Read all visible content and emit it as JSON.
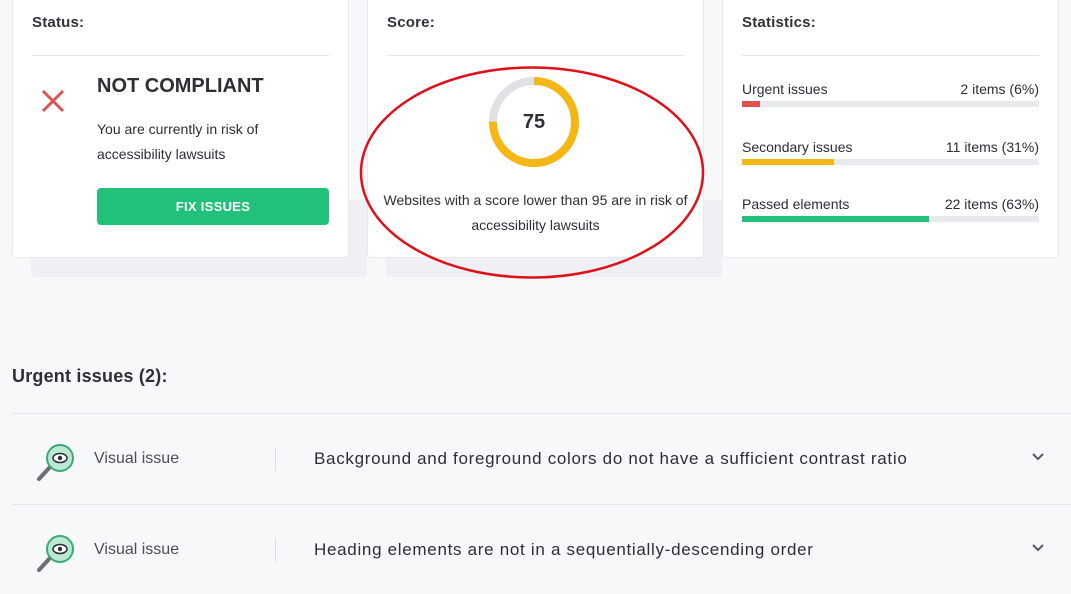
{
  "status_card": {
    "title": "Status:",
    "heading": "NOT COMPLIANT",
    "description": "You are currently in risk of accessibility lawsuits",
    "fix_button": "FIX ISSUES"
  },
  "score_card": {
    "title": "Score:",
    "score": 75,
    "score_label": "75",
    "description": "Websites with a score lower than 95 are in risk of accessibility lawsuits"
  },
  "statistics_card": {
    "title": "Statistics:",
    "rows": [
      {
        "label": "Urgent issues",
        "value": "2 items (6%)",
        "percent": 6,
        "color": "#e05252"
      },
      {
        "label": "Secondary issues",
        "value": "11 items (31%)",
        "percent": 31,
        "color": "#f5b713"
      },
      {
        "label": "Passed elements",
        "value": "22 items (63%)",
        "percent": 63,
        "color": "#22c17a"
      }
    ]
  },
  "colors": {
    "accent_green": "#22c17a",
    "score_ring": "#f5b713",
    "error_red": "#e05252",
    "annotation_red": "#e0101a"
  },
  "urgent_issues": {
    "title": "Urgent issues (2):",
    "items": [
      {
        "type": "Visual issue",
        "text": "Background and foreground colors do not have a sufficient contrast ratio",
        "icon": "magnifier-eye-icon"
      },
      {
        "type": "Visual issue",
        "text": "Heading elements are not in a sequentially-descending order",
        "icon": "magnifier-eye-icon"
      }
    ]
  }
}
